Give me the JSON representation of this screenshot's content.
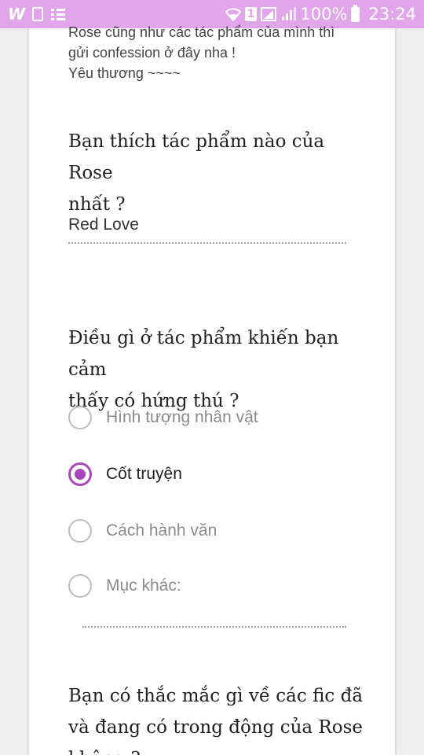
{
  "status_bar": {
    "app_icon": "W",
    "battery_percent": "100%",
    "time": "23:24",
    "sim_slot": "1",
    "icons": [
      "wattpad-icon",
      "document-icon",
      "list-icon",
      "wifi-icon",
      "sim-icon",
      "signal-icon",
      "battery-icon"
    ]
  },
  "form": {
    "description_lines": [
      "Rose cũng như các tác phẩm của mình thì",
      "gửi confession ở đây nha !",
      "Yêu thương ~~~~"
    ],
    "q1": {
      "title_line1": "Bạn thích tác phẩm nào của Rose",
      "title_line2": "nhất ?",
      "answer": "Red Love"
    },
    "q2": {
      "title_line1": "Điều gì ở tác phẩm khiến bạn cảm",
      "title_line2": "thấy có hứng thú ?",
      "options": [
        {
          "label": "Hình tượng nhân vật",
          "selected": false
        },
        {
          "label": "Cốt truyện",
          "selected": true
        },
        {
          "label": "Cách hành văn",
          "selected": false
        },
        {
          "label": "Mục khác:",
          "selected": false
        }
      ]
    },
    "q3": {
      "title_line1": "Bạn có thắc mắc gì về các fic đã",
      "title_line2": "và đang có trong động của Rose",
      "title_line3": "không ?"
    }
  },
  "colors": {
    "status_bar": "#e1a6ea",
    "accent": "#ab47bc"
  }
}
